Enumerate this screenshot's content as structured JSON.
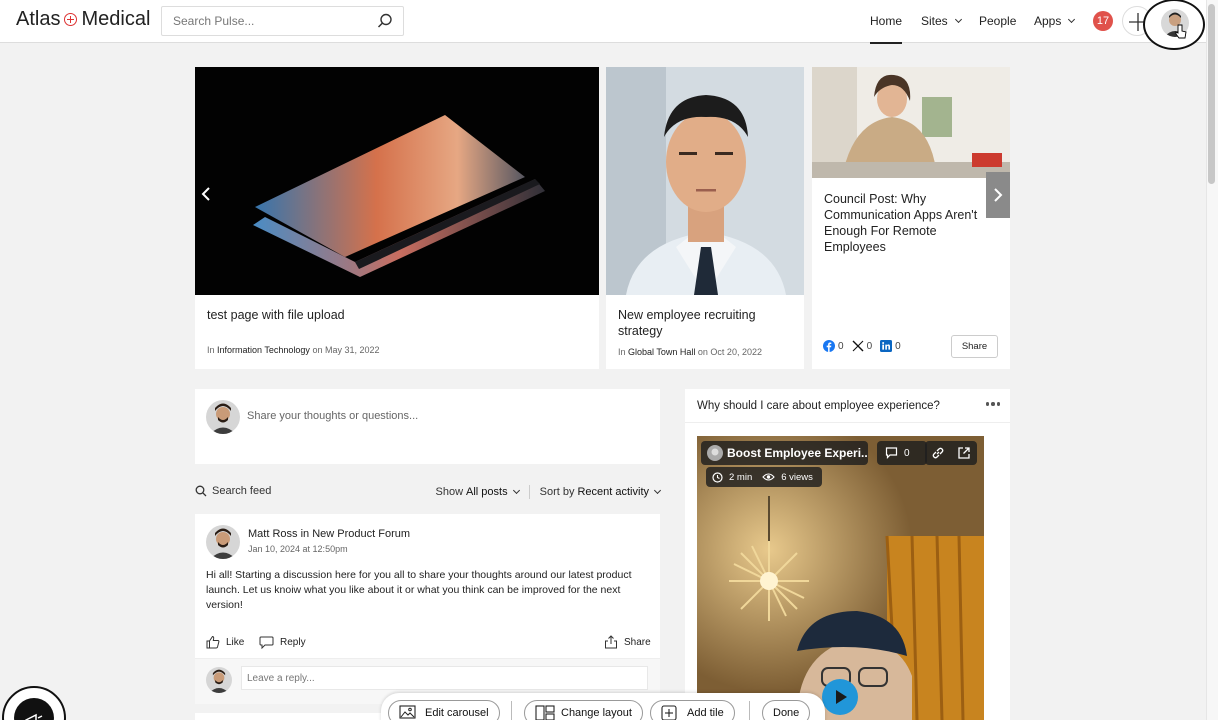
{
  "header": {
    "logo_left": "Atlas",
    "logo_right": "Medical",
    "search_placeholder": "Search Pulse...",
    "nav": {
      "home": "Home",
      "sites": "Sites",
      "people": "People",
      "apps": "Apps"
    },
    "notifications_count": "17"
  },
  "carousel": {
    "items": [
      {
        "title": "test page with file upload",
        "meta_prefix": "In",
        "meta_place": "Information Technology",
        "meta_suffix": "on May 31, 2022"
      },
      {
        "title": "New employee recruiting strategy",
        "meta_prefix": "In",
        "meta_place": "Global Town Hall",
        "meta_suffix": "on Oct 20, 2022"
      },
      {
        "title": "Council Post: Why Communication Apps Aren't Enough For Remote Employees",
        "share_label": "Share",
        "social": {
          "facebook": "0",
          "x": "0",
          "linkedin": "0"
        }
      }
    ]
  },
  "composer": {
    "placeholder": "Share your thoughts or questions..."
  },
  "feed_controls": {
    "search_label": "Search feed",
    "show_prefix": "Show",
    "show_value": "All posts",
    "sort_prefix": "Sort by",
    "sort_value": "Recent activity"
  },
  "post": {
    "author": "Matt Ross",
    "in_word": "in",
    "forum": "New Product Forum",
    "date": "Jan 10, 2024 at 12:50pm",
    "body": "Hi all! Starting a discussion here for you all to share your thoughts around our latest product launch. Let us knoiw what you like about it or what you think can be improved for the next version!",
    "like_label": "Like",
    "reply_label": "Reply",
    "share_label": "Share",
    "reply_placeholder": "Leave a reply..."
  },
  "widget": {
    "title": "Why should I care about employee experience?",
    "video": {
      "title": "Boost Employee Experi...",
      "comments": "0",
      "duration": "2 min",
      "views": "6 views"
    }
  },
  "bottom_bar": {
    "edit_carousel": "Edit carousel",
    "change_layout": "Change layout",
    "add_tile": "Add tile",
    "done": "Done"
  },
  "colors": {
    "accent_red": "#d33333",
    "badge_red": "#e0524b",
    "play_blue": "#2196d9"
  }
}
